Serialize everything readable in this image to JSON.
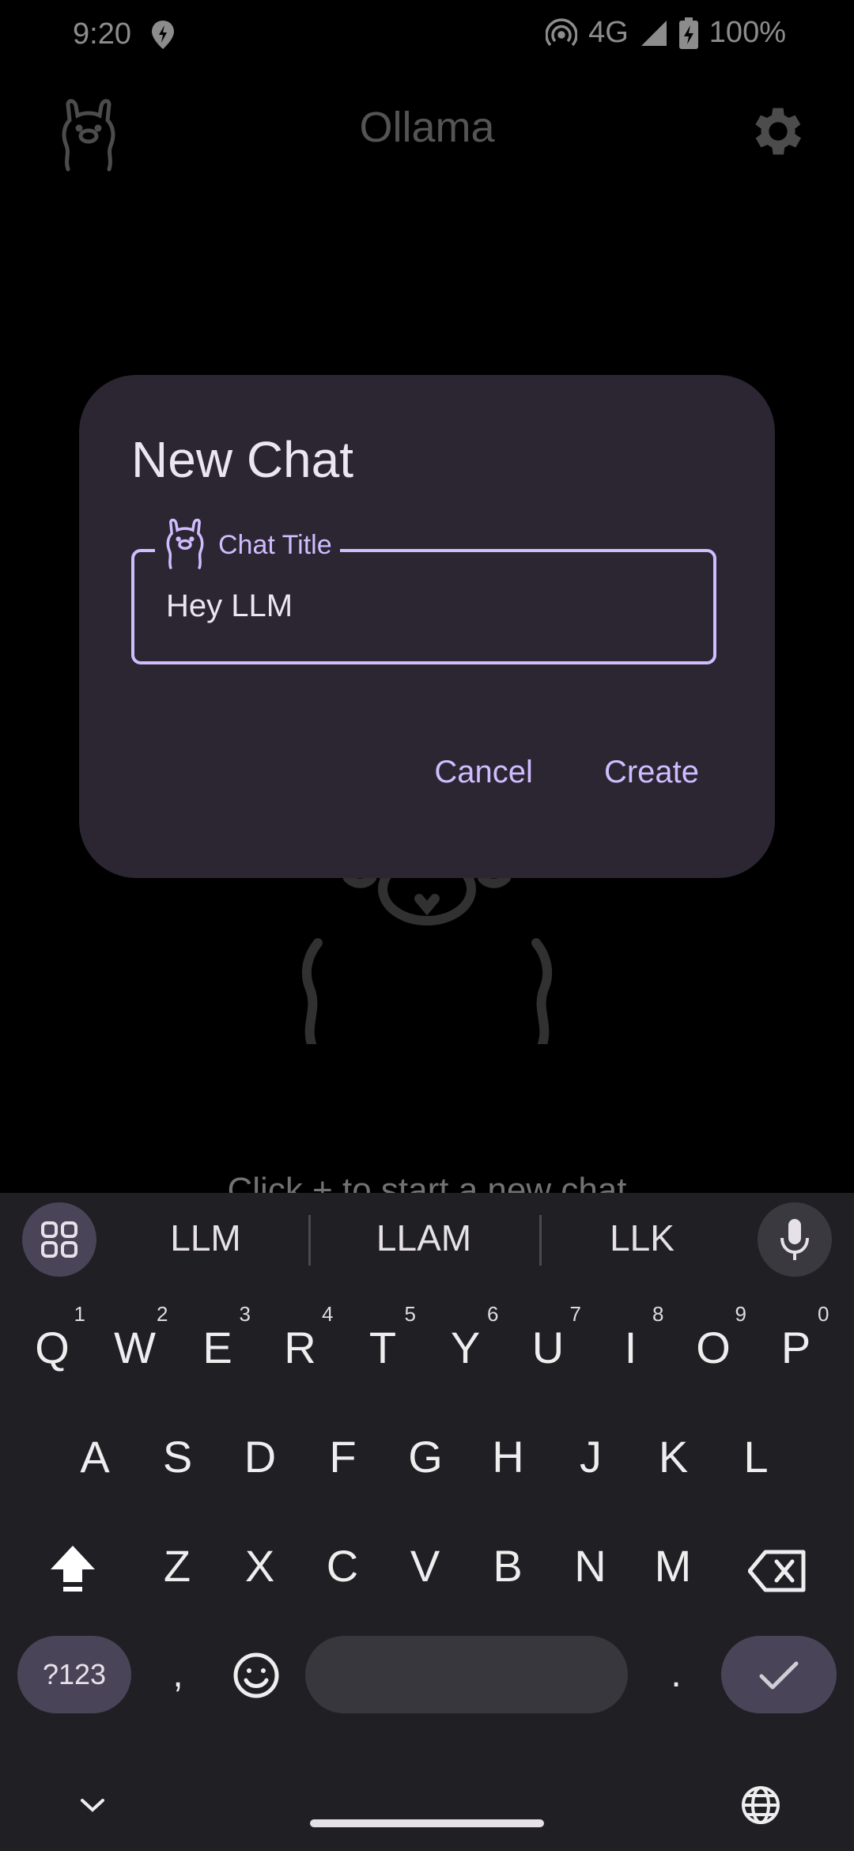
{
  "status_bar": {
    "time": "9:20",
    "network": "4G",
    "battery": "100%",
    "icons": [
      "maps-pin-icon",
      "hotspot-icon",
      "signal-icon",
      "battery-charging-icon"
    ]
  },
  "app_bar": {
    "title": "Ollama",
    "logo_icon": "llama-icon",
    "settings_icon": "gear-icon"
  },
  "background": {
    "hint_text": "Click + to start a new chat"
  },
  "dialog": {
    "title": "New Chat",
    "field_label": "Chat Title",
    "field_value": "Hey LLM",
    "cancel_label": "Cancel",
    "create_label": "Create"
  },
  "keyboard": {
    "suggestions": [
      "LLM",
      "LLAM",
      "LLK"
    ],
    "row1": [
      {
        "k": "Q",
        "n": "1"
      },
      {
        "k": "W",
        "n": "2"
      },
      {
        "k": "E",
        "n": "3"
      },
      {
        "k": "R",
        "n": "4"
      },
      {
        "k": "T",
        "n": "5"
      },
      {
        "k": "Y",
        "n": "6"
      },
      {
        "k": "U",
        "n": "7"
      },
      {
        "k": "I",
        "n": "8"
      },
      {
        "k": "O",
        "n": "9"
      },
      {
        "k": "P",
        "n": "0"
      }
    ],
    "row2": [
      "A",
      "S",
      "D",
      "F",
      "G",
      "H",
      "J",
      "K",
      "L"
    ],
    "row3": [
      "Z",
      "X",
      "C",
      "V",
      "B",
      "N",
      "M"
    ],
    "symbols_label": "?123",
    "comma": ",",
    "period": ".",
    "colors": {
      "accent": "#d0bcff",
      "dialog_bg": "#2b2631",
      "keyboard_bg": "#201f24"
    }
  }
}
